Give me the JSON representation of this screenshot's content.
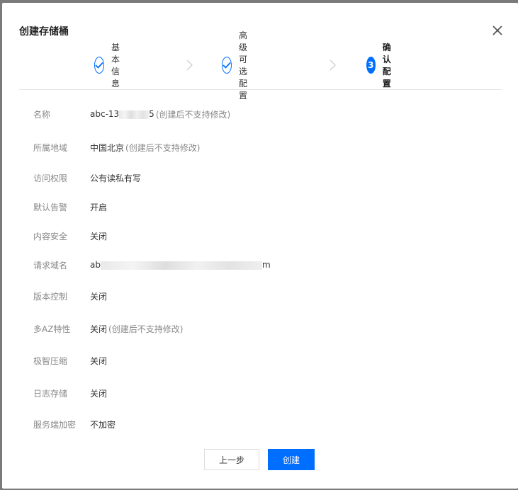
{
  "dialog": {
    "title": "创建存储桶",
    "close_icon": "close-icon"
  },
  "steps": [
    {
      "label": "基本信息",
      "status": "done",
      "icon": "check-icon"
    },
    {
      "label": "高级可选配置",
      "status": "done",
      "icon": "check-icon"
    },
    {
      "label": "确认配置",
      "status": "active",
      "number": "3"
    }
  ],
  "summary": {
    "name": {
      "label": "名称",
      "value_start": "abc-13",
      "value_end": "5",
      "note": "(创建后不支持修改)"
    },
    "region": {
      "label": "所属地域",
      "value": "中国北京",
      "note": "(创建后不支持修改)"
    },
    "access": {
      "label": "访问权限",
      "value": "公有读私有写"
    },
    "alert": {
      "label": "默认告警",
      "value": "开启"
    },
    "content_security": {
      "label": "内容安全",
      "value": "关闭"
    },
    "domain": {
      "label": "请求域名",
      "value_start": "ab",
      "value_end": "m"
    },
    "versioning": {
      "label": "版本控制",
      "value": "关闭"
    },
    "multi_az": {
      "label": "多AZ特性",
      "value": "关闭",
      "note": "(创建后不支持修改)"
    },
    "compression": {
      "label": "极智压缩",
      "value": "关闭"
    },
    "log_storage": {
      "label": "日志存储",
      "value": "关闭"
    },
    "encryption": {
      "label": "服务端加密",
      "value": "不加密"
    }
  },
  "footer": {
    "prev_label": "上一步",
    "create_label": "创建"
  },
  "colors": {
    "primary": "#006eff",
    "label": "#888888",
    "text": "#333333"
  }
}
